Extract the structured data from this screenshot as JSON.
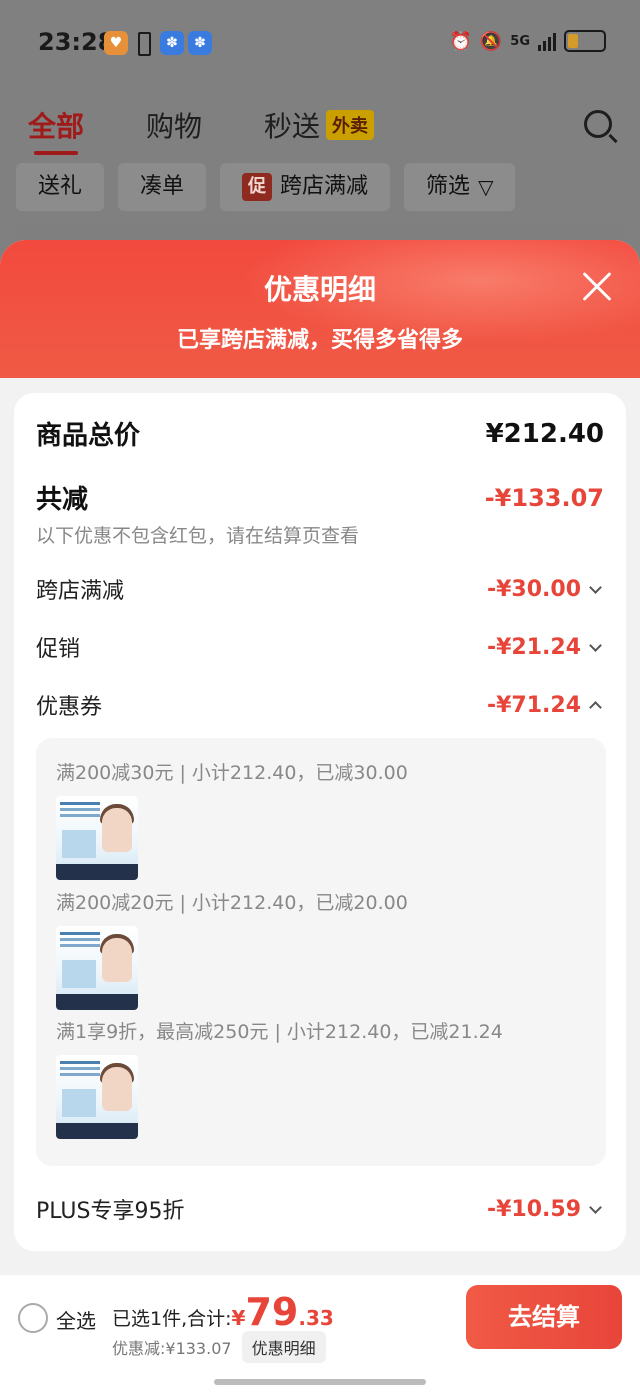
{
  "status_bar": {
    "time": "23:28",
    "network": "5G"
  },
  "top_tabs": [
    {
      "label": "全部",
      "active": true
    },
    {
      "label": "购物",
      "active": false
    },
    {
      "label": "秒送",
      "active": false
    }
  ],
  "waimai_badge": "外卖",
  "filter_chips": {
    "gift": "送礼",
    "bundle": "凑单",
    "promo_tag": "促",
    "cross_store": "跨店满减",
    "filter": "筛选"
  },
  "sheet": {
    "title": "优惠明细",
    "subtitle": "已享跨店满减，买得多省得多"
  },
  "summary": {
    "total_label": "商品总价",
    "total_value": "¥212.40",
    "reduce_label": "共减",
    "reduce_value": "-¥133.07",
    "note": "以下优惠不包含红包，请在结算页查看"
  },
  "discounts": [
    {
      "label": "跨店满减",
      "value": "-¥30.00",
      "expanded": false
    },
    {
      "label": "促销",
      "value": "-¥21.24",
      "expanded": false
    },
    {
      "label": "优惠券",
      "value": "-¥71.24",
      "expanded": true
    }
  ],
  "coupons": [
    {
      "line": "满200减30元 | 小计212.40，已减30.00"
    },
    {
      "line": "满200减20元 | 小计212.40，已减20.00"
    },
    {
      "line": "满1享9折，最高减250元 | 小计212.40，已减21.24"
    }
  ],
  "plus": {
    "label": "PLUS专享95折",
    "value": "-¥10.59"
  },
  "bottom_bar": {
    "select_all": "全选",
    "selected_text": "已选1件,合计:",
    "currency": "¥",
    "total_int": "79",
    "total_dec": ".33",
    "discount_text": "优惠减:¥133.07",
    "detail_button": "优惠明细",
    "checkout_button": "去结算"
  },
  "colors": {
    "accent_red": "#e8453a",
    "header_red": "#f24a3e"
  }
}
